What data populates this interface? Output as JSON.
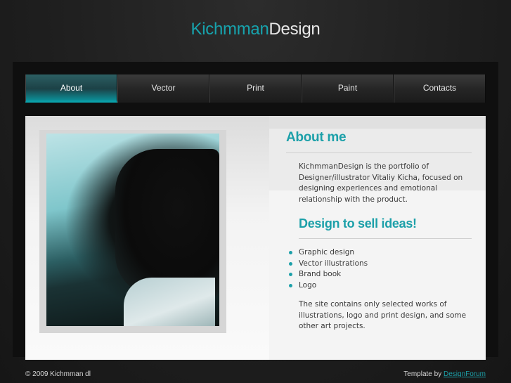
{
  "logo": {
    "part1": "Kichmman",
    "part2": "Design"
  },
  "nav": {
    "items": [
      {
        "label": "About"
      },
      {
        "label": "Vector"
      },
      {
        "label": "Print"
      },
      {
        "label": "Paint"
      },
      {
        "label": "Contacts"
      }
    ],
    "active": "About"
  },
  "about": {
    "heading": "About me",
    "text": "KichmmanDesign is the portfolio of Designer/illustrator Vitaliy Kicha, focused on designing experiences and emotional relationship with the product."
  },
  "sell": {
    "heading": "Design to sell ideas!",
    "services": [
      "Graphic design",
      "Vector illustrations",
      "Brand book",
      "Logo"
    ],
    "text": "The site contains only selected works of illustrations, logo and print design, and some other art projects."
  },
  "footer": {
    "copyright": "© 2009 Kichmman dl",
    "template_prefix": "Template by",
    "template_link": "DesignForum"
  },
  "colors": {
    "accent": "#1ca0a9",
    "background": "#1e1e1e"
  }
}
